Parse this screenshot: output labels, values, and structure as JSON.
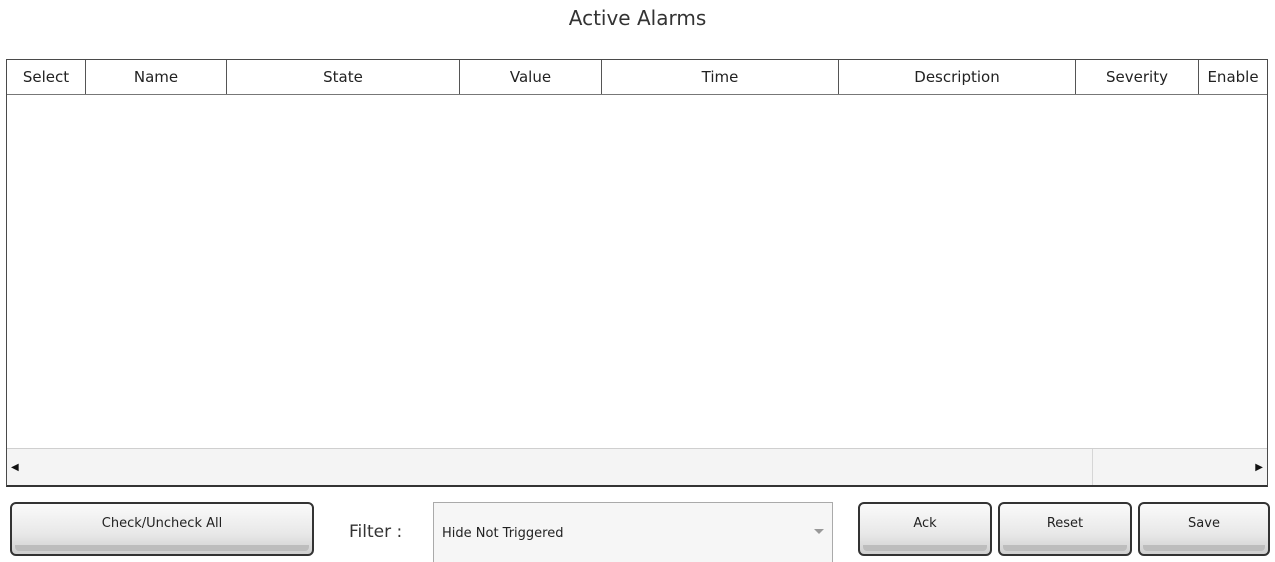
{
  "title": "Active Alarms",
  "table": {
    "columns": [
      "Select",
      "Name",
      "State",
      "Value",
      "Time",
      "Description",
      "Severity",
      "Enable"
    ],
    "rows": []
  },
  "controls": {
    "check_all_label": "Check/Uncheck All",
    "filter_label": "Filter :",
    "filter_value": "Hide Not Triggered",
    "ack_label": "Ack",
    "reset_label": "Reset",
    "save_label": "Save"
  },
  "icons": {
    "scroll_left": "scroll-left-arrow-icon",
    "scroll_right": "scroll-right-arrow-icon",
    "dropdown": "chevron-down-icon"
  }
}
